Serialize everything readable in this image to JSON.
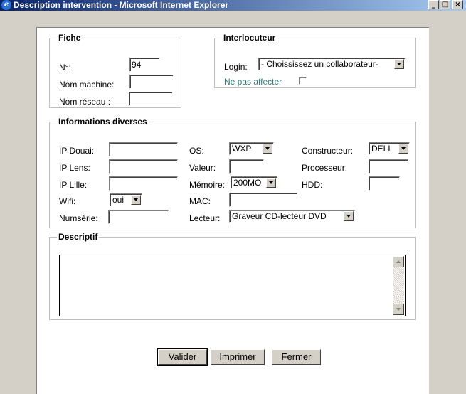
{
  "window": {
    "title": "Description intervention - Microsoft Internet Explorer",
    "icon": "ie-icon",
    "buttons": {
      "min": "_",
      "max": "□",
      "close": "×"
    }
  },
  "fiche": {
    "legend": "Fiche",
    "num_label": "N°:",
    "num_value": "94",
    "machine_label": "Nom machine:",
    "machine_value": "",
    "reseau_label": "Nom réseau :",
    "reseau_value": ""
  },
  "interlocuteur": {
    "legend": "Interlocuteur",
    "login_label": "Login:",
    "login_value": "- Choississez un collaborateur-",
    "ne_pas_affecter": "Ne pas affecter",
    "ne_pas_affecter_checked": false
  },
  "infos": {
    "legend": "Informations diverses",
    "ip_douai_label": "IP Douai:",
    "ip_douai": "",
    "ip_lens_label": "IP Lens:",
    "ip_lens": "",
    "ip_lille_label": "IP Lille:",
    "ip_lille": "",
    "wifi_label": "Wifi:",
    "wifi": "oui",
    "numserie_label": "Numsérie:",
    "numserie": "",
    "os_label": "OS:",
    "os": "WXP",
    "valeur_label": "Valeur:",
    "valeur": "",
    "memoire_label": "Mémoire:",
    "memoire": "200MO",
    "mac_label": "MAC:",
    "mac": "",
    "lecteur_label": "Lecteur:",
    "lecteur": "Graveur CD-lecteur DVD",
    "constructeur_label": "Constructeur:",
    "constructeur": "DELL",
    "processeur_label": "Processeur:",
    "processeur": "",
    "hdd_label": "HDD:",
    "hdd": ""
  },
  "descriptif": {
    "legend": "Descriptif",
    "text": ""
  },
  "actions": {
    "valider": "Valider",
    "imprimer": "Imprimer",
    "fermer": "Fermer"
  }
}
